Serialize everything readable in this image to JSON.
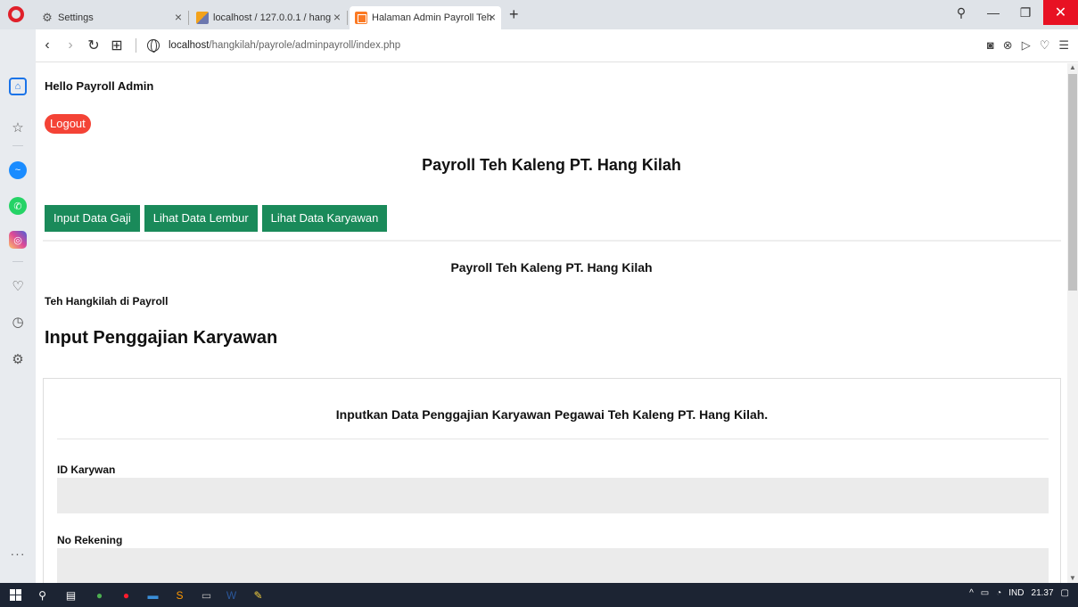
{
  "browser": {
    "tabs": [
      {
        "title": "Settings",
        "icon": "gear-icon"
      },
      {
        "title": "localhost / 127.0.0.1 / hang",
        "icon": "phpmyadmin-icon"
      },
      {
        "title": "Halaman Admin Payroll Teh",
        "icon": "xampp-icon",
        "active": true
      }
    ],
    "url_host": "localhost",
    "url_path": "/hangkilah/payrole/adminpayroll/index.php"
  },
  "page": {
    "greeting": "Hello Payroll Admin",
    "logout_label": "Logout",
    "main_title": "Payroll Teh Kaleng PT. Hang Kilah",
    "nav": {
      "input_gaji": "Input Data Gaji",
      "lihat_lembur": "Lihat Data Lembur",
      "lihat_karyawan": "Lihat Data Karyawan"
    },
    "sub_title": "Payroll Teh Kaleng PT. Hang Kilah",
    "small_title": "Teh Hangkilah di Payroll",
    "form_heading": "Input Penggajian Karyawan",
    "card_title": "Inputkan Data Penggajian Karyawan Pegawai Teh Kaleng PT. Hang Kilah.",
    "fields": [
      {
        "label": "ID Karywan",
        "value": ""
      },
      {
        "label": "No Rekening",
        "value": ""
      }
    ],
    "button_color": "#1a8a5a",
    "logout_color": "#f44336"
  },
  "taskbar": {
    "language": "IND",
    "time": "21.37"
  }
}
